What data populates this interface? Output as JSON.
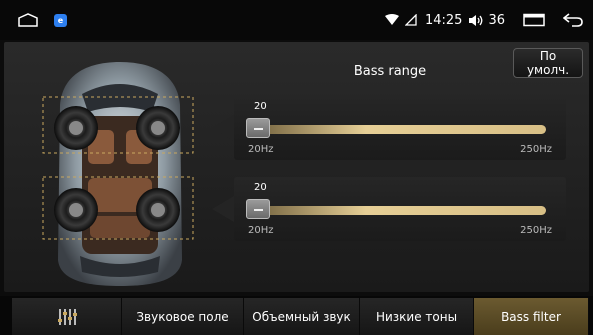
{
  "status_bar": {
    "time": "14:25",
    "volume": "36",
    "app_badge_letter": "e",
    "icons": [
      "home-icon",
      "app-icon",
      "wifi-icon",
      "signal-icon",
      "volume-icon",
      "window-icon",
      "back-icon"
    ]
  },
  "header": {
    "default_button": "По умолч.",
    "title": "Bass range"
  },
  "sliders": [
    {
      "value": "20",
      "min_label": "20Hz",
      "max_label": "250Hz",
      "level": 0.0
    },
    {
      "value": "20",
      "min_label": "20Hz",
      "max_label": "250Hz",
      "level": 0.0
    }
  ],
  "tabs": [
    {
      "label": "",
      "icon": "equalizer-icon",
      "active": false
    },
    {
      "label": "Звуковое поле",
      "active": false
    },
    {
      "label": "Объемный звук",
      "active": false
    },
    {
      "label": "Низкие тоны",
      "active": false
    },
    {
      "label": "Bass filter",
      "active": true
    }
  ],
  "colors": {
    "accent": "#d8bf86",
    "active_tab": "#5a4a24"
  }
}
